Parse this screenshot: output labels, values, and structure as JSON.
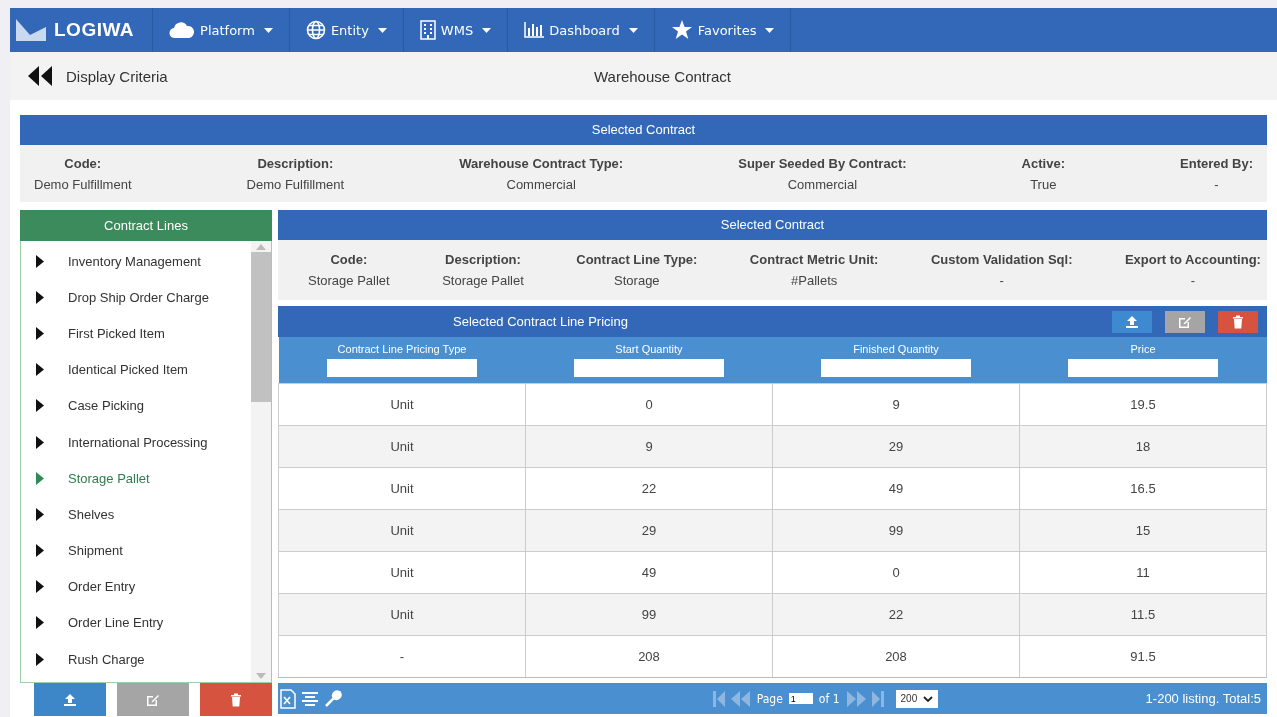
{
  "nav": {
    "logo": "LOGIWA",
    "menus": [
      {
        "label": "Platform",
        "kind": "cloud"
      },
      {
        "label": "Entity",
        "kind": "globe"
      },
      {
        "label": "WMS",
        "kind": "building"
      },
      {
        "label": "Dashboard",
        "kind": "chart"
      },
      {
        "label": "Favorites",
        "kind": "star"
      }
    ]
  },
  "header": {
    "back_label": "Display Criteria",
    "title": "Warehouse Contract"
  },
  "contract": {
    "title": "Selected Contract",
    "fields": [
      {
        "label": "Code:",
        "value": "Demo Fulfillment"
      },
      {
        "label": "Description:",
        "value": "Demo Fulfillment"
      },
      {
        "label": "Warehouse Contract Type:",
        "value": "Commercial"
      },
      {
        "label": "Super Seeded By Contract:",
        "value": "Commercial"
      },
      {
        "label": "Active:",
        "value": "True"
      },
      {
        "label": "Entered By:",
        "value": "-"
      }
    ]
  },
  "contract_lines": {
    "title": "Contract Lines",
    "items": [
      {
        "label": "Inventory Management",
        "selected": false
      },
      {
        "label": "Drop Ship Order Charge",
        "selected": false
      },
      {
        "label": "First Picked Item",
        "selected": false
      },
      {
        "label": "Identical Picked Item",
        "selected": false
      },
      {
        "label": "Case Picking",
        "selected": false
      },
      {
        "label": "International Processing",
        "selected": false
      },
      {
        "label": "Storage Pallet",
        "selected": true
      },
      {
        "label": "Shelves",
        "selected": false
      },
      {
        "label": "Shipment",
        "selected": false
      },
      {
        "label": "Order Entry",
        "selected": false
      },
      {
        "label": "Order Line Entry",
        "selected": false
      },
      {
        "label": "Rush Charge",
        "selected": false
      }
    ]
  },
  "line": {
    "title": "Selected Contract",
    "fields": [
      {
        "label": "Code:",
        "value": "Storage Pallet"
      },
      {
        "label": "Description:",
        "value": "Storage Pallet"
      },
      {
        "label": "Contract Line Type:",
        "value": "Storage"
      },
      {
        "label": "Contract Metric Unit:",
        "value": "#Pallets"
      },
      {
        "label": "Custom Validation Sql:",
        "value": "-"
      },
      {
        "label": "Export to Accounting:",
        "value": "-"
      }
    ]
  },
  "pricing": {
    "title": "Selected Contract Line Pricing",
    "columns": [
      "Contract Line Pricing Type",
      "Start Quantity",
      "Finished Quantity",
      "Price"
    ],
    "rows": [
      [
        "Unit",
        "0",
        "9",
        "19.5"
      ],
      [
        "Unit",
        "9",
        "29",
        "18"
      ],
      [
        "Unit",
        "22",
        "49",
        "16.5"
      ],
      [
        "Unit",
        "29",
        "99",
        "15"
      ],
      [
        "Unit",
        "49",
        "0",
        "11"
      ],
      [
        "Unit",
        "99",
        "22",
        "11.5"
      ],
      [
        "-",
        "208",
        "208",
        "91.5"
      ]
    ],
    "pager": {
      "page_label": "Page",
      "page": "1",
      "of_label": "of 1",
      "page_size": "200",
      "summary": "1-200 listing. Total:5"
    }
  }
}
